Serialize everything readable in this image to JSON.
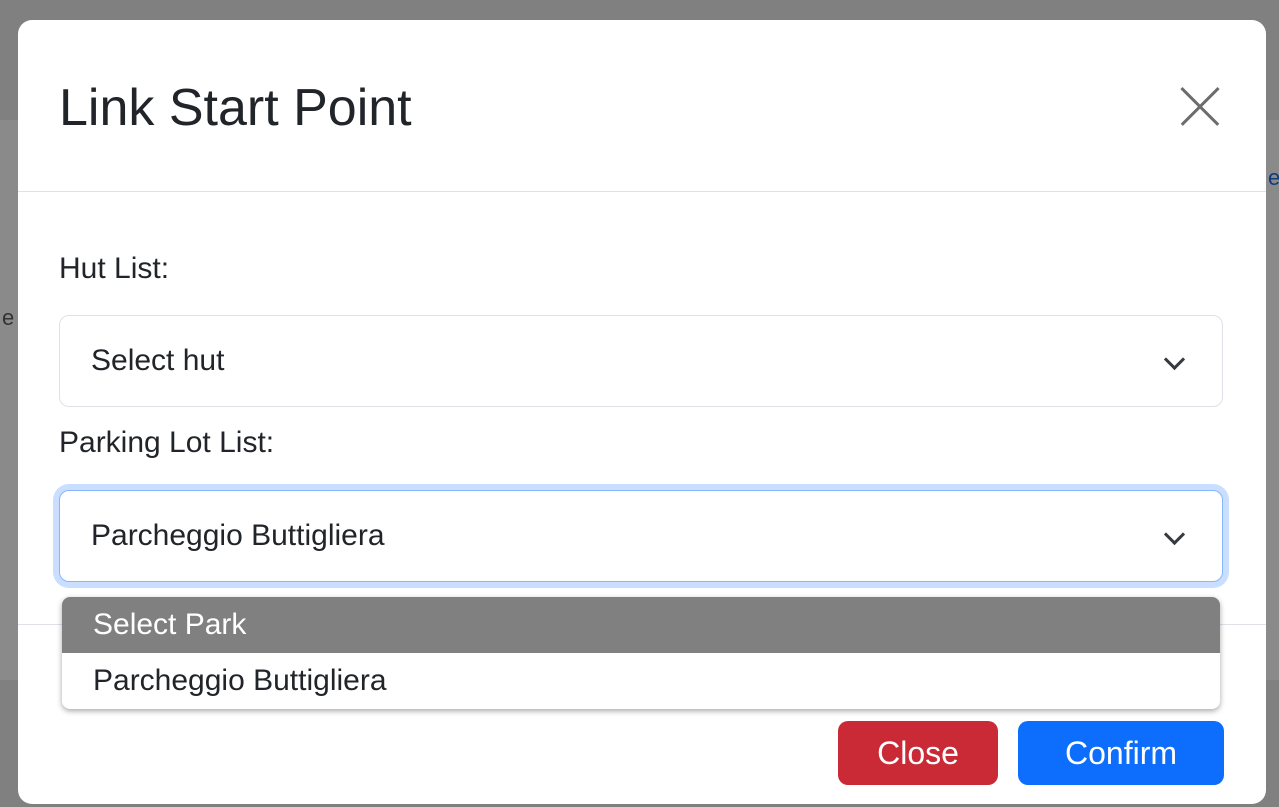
{
  "modal": {
    "title": "Link Start Point"
  },
  "form": {
    "hut_label": "Hut List:",
    "hut_value": "Select hut",
    "parking_label": "Parking Lot List:",
    "parking_value": "Parcheggio Buttigliera"
  },
  "dropdown": {
    "options": [
      "Select Park",
      "Parcheggio Buttigliera"
    ],
    "highlighted_index": 0
  },
  "footer": {
    "close_label": "Close",
    "confirm_label": "Confirm"
  },
  "colors": {
    "primary": "#0d6efd",
    "danger": "#c92a36",
    "focus_ring": "#86b7fe",
    "highlight": "#808080"
  }
}
